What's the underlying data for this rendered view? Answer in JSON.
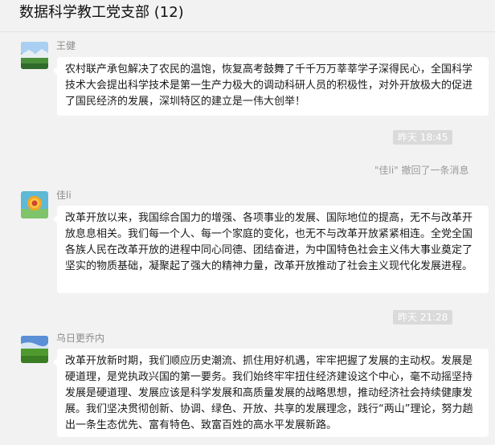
{
  "header": {
    "title": "数据科学教工党支部 (12)"
  },
  "messages": [
    {
      "sender": "王健",
      "avatar_icon": "landscape-avatar",
      "text": "农村联产承包解决了农民的温饱，恢复高考鼓舞了千千万万莘莘学子深得民心，全国科学技术大会提出科学技术是第一生产力极大的调动科研人员的积极性，对外开放极大的促进了国民经济的发展，深圳特区的建立是一伟大创举！"
    },
    {
      "sender": "佳li",
      "avatar_icon": "sunflower-avatar",
      "text": "改革开放以来，我国综合国力的增强、各项事业的发展、国际地位的提高，无不与改革开放息息相关。我们每一个人、每一个家庭的变化，也无不与改革开放紧紧相连。全党全国各族人民在改革开放的进程中同心同德、团结奋进，为中国特色社会主义伟大事业奠定了坚实的物质基础，凝聚起了强大的精神力量，改革开放推动了社会主义现代化发展进程。"
    },
    {
      "sender": "乌日更乔内",
      "avatar_icon": "grassland-avatar",
      "text": "改革开放新时期，我们顺应历史潮流、抓住用好机遇，牢牢把握了发展的主动权。发展是硬道理，是党执政兴国的第一要务。我们始终牢牢扭住经济建设这个中心，毫不动摇坚持发展是硬道理、发展应该是科学发展和高质量发展的战略思想，推动经济社会持续健康发展。我们坚决贯彻创新、协调、绿色、开放、共享的发展理念，践行“两山”理论，努力趟出一条生态优先、富有特色、致富百姓的高水平发展新路。"
    }
  ],
  "timestamps": [
    "昨天 18:45",
    "昨天 21:28"
  ],
  "system_notice": "\"佳li\" 撤回了一条消息",
  "colors": {
    "background": "#f2f2f2",
    "bubble": "#ffffff",
    "timestamp_bg": "#dadada",
    "sender_text": "#8c8c8c"
  }
}
